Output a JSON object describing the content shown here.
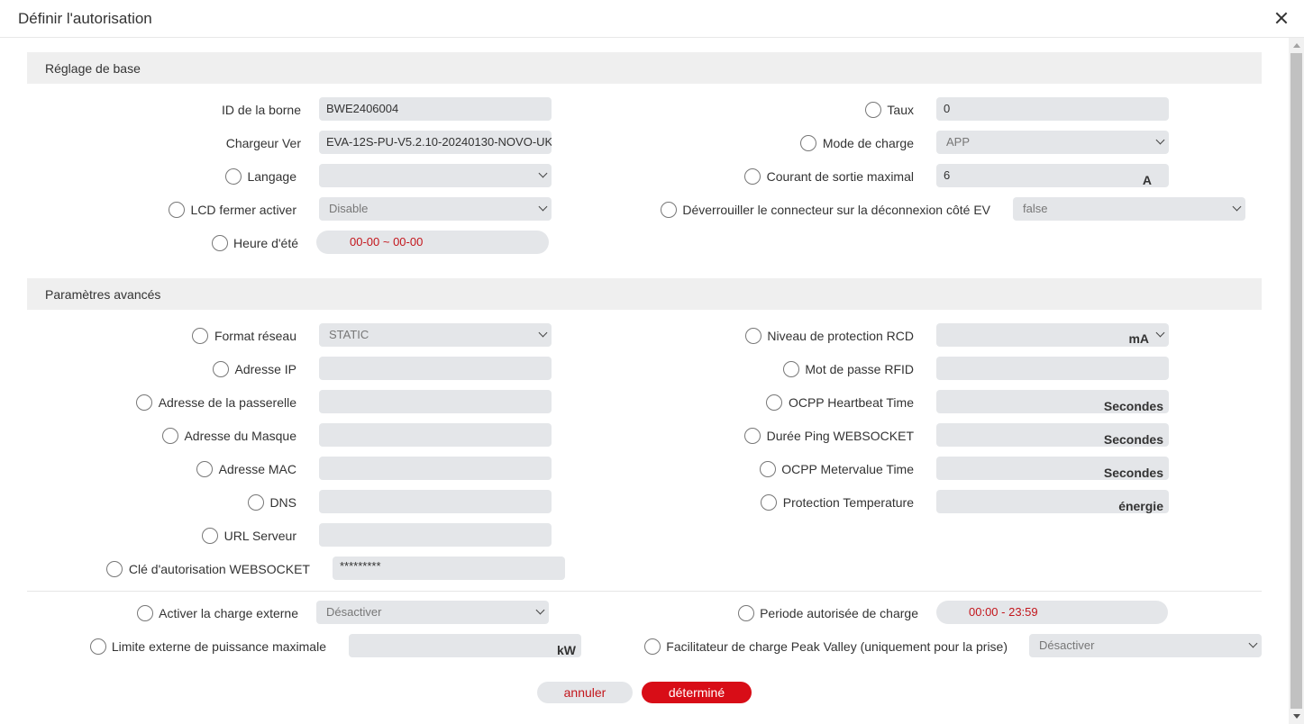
{
  "dialog": {
    "title": "Définir l'autorisation"
  },
  "basic": {
    "section_title": "Réglage de base",
    "borne_id": {
      "label": "ID de la borne",
      "value": "BWE2406004"
    },
    "charger_ver": {
      "label": "Chargeur Ver",
      "value": "EVA-12S-PU-V5.2.10-20240130-NOVO-UK"
    },
    "langage": {
      "label": "Langage",
      "value": ""
    },
    "lcd": {
      "label": "LCD fermer activer",
      "value": "Disable"
    },
    "summer_time": {
      "label": "Heure d'été",
      "value": "00-00 ~ 00-00"
    },
    "taux": {
      "label": "Taux",
      "value": "0"
    },
    "mode_charge": {
      "label": "Mode de charge",
      "value": "APP"
    },
    "courant_max": {
      "label": "Courant de sortie maximal",
      "value": "6",
      "unit": "A"
    },
    "unlock": {
      "label": "Déverrouiller le connecteur sur la déconnexion côté EV",
      "value": "false"
    }
  },
  "advanced": {
    "section_title": "Paramètres avancés",
    "format_reseau": {
      "label": "Format réseau",
      "value": "STATIC"
    },
    "adresse_ip": {
      "label": "Adresse IP",
      "value": ""
    },
    "passerelle": {
      "label": "Adresse de la passerelle",
      "value": ""
    },
    "masque": {
      "label": "Adresse du Masque",
      "value": ""
    },
    "mac": {
      "label": "Adresse MAC",
      "value": ""
    },
    "dns": {
      "label": "DNS",
      "value": ""
    },
    "url": {
      "label": "URL Serveur",
      "value": ""
    },
    "ws_key": {
      "label": "Clé d'autorisation WEBSOCKET",
      "value": "*********"
    },
    "rcd": {
      "label": "Niveau de protection RCD",
      "unit": "mA"
    },
    "rfid": {
      "label": "Mot de passe RFID",
      "value": ""
    },
    "heartbeat": {
      "label": "OCPP Heartbeat Time",
      "unit": "Secondes"
    },
    "ping": {
      "label": "Durée Ping WEBSOCKET",
      "unit": "Secondes"
    },
    "metervalue": {
      "label": "OCPP Metervalue Time",
      "unit": "Secondes"
    },
    "temperature": {
      "label": "Protection Temperature",
      "unit": "énergie"
    }
  },
  "external": {
    "activer": {
      "label": "Activer la charge externe",
      "value": "Désactiver"
    },
    "limite": {
      "label": "Limite externe de puissance maximale",
      "unit": "kW"
    },
    "periode": {
      "label": "Periode autorisée de charge",
      "value": "00:00 - 23:59"
    },
    "peak_valley": {
      "label": "Facilitateur de charge Peak Valley (uniquement pour la prise)",
      "value": "Désactiver"
    }
  },
  "buttons": {
    "cancel": "annuler",
    "ok": "déterminé"
  },
  "colors": {
    "accent": "#d80d17",
    "field_bg": "#e4e6e9",
    "section_bg": "#efefef",
    "time_text": "#c3161c"
  }
}
